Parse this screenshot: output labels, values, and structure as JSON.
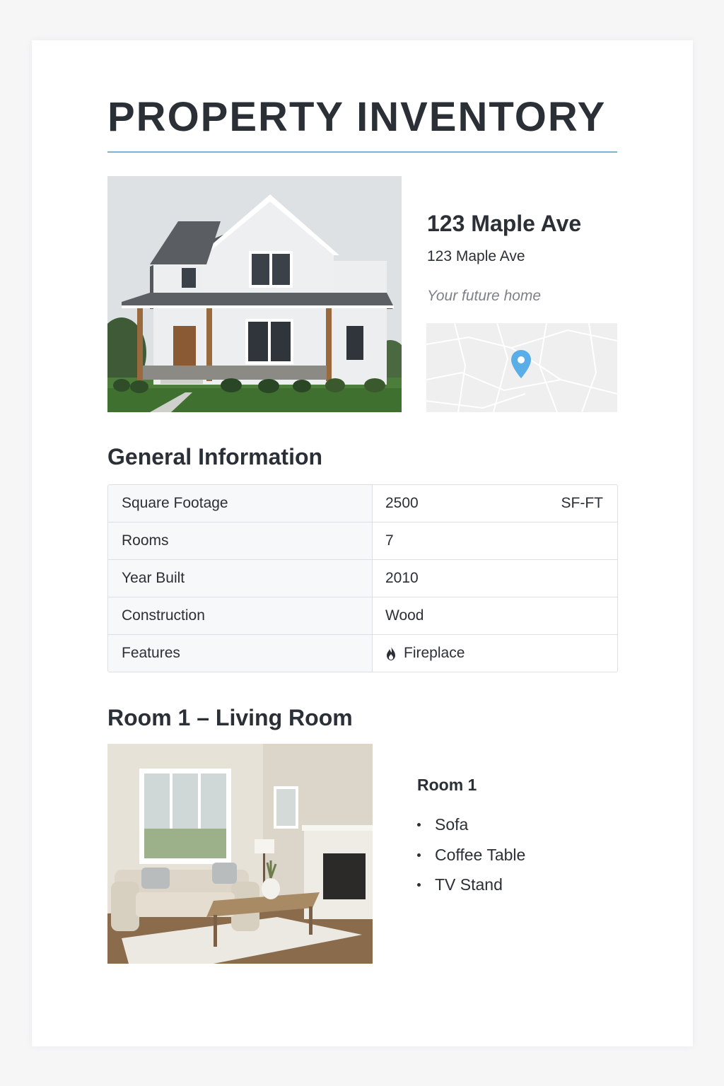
{
  "page": {
    "title": "PROPERTY INVENTORY"
  },
  "property": {
    "heading": "123 Maple Ave",
    "address": "123 Maple Ave",
    "tagline": "Your future home",
    "photo_icon": "house-photo",
    "map_icon": "map-pin-icon"
  },
  "general": {
    "heading": "General Information",
    "rows": [
      {
        "label": "Square Footage",
        "value": "2500",
        "unit": "SF-FT"
      },
      {
        "label": "Rooms",
        "value": "7"
      },
      {
        "label": "Year Built",
        "value": "2010"
      },
      {
        "label": "Construction",
        "value": "Wood"
      },
      {
        "label": "Features",
        "value": "Fireplace",
        "icon": "flame-icon"
      }
    ]
  },
  "room1": {
    "heading": "Room 1 – Living Room",
    "name": "Room 1",
    "items": [
      "Sofa",
      "Coffee Table",
      "TV Stand"
    ]
  },
  "colors": {
    "accent_rule": "#7ab3d6",
    "map_pin": "#5aaee8"
  }
}
